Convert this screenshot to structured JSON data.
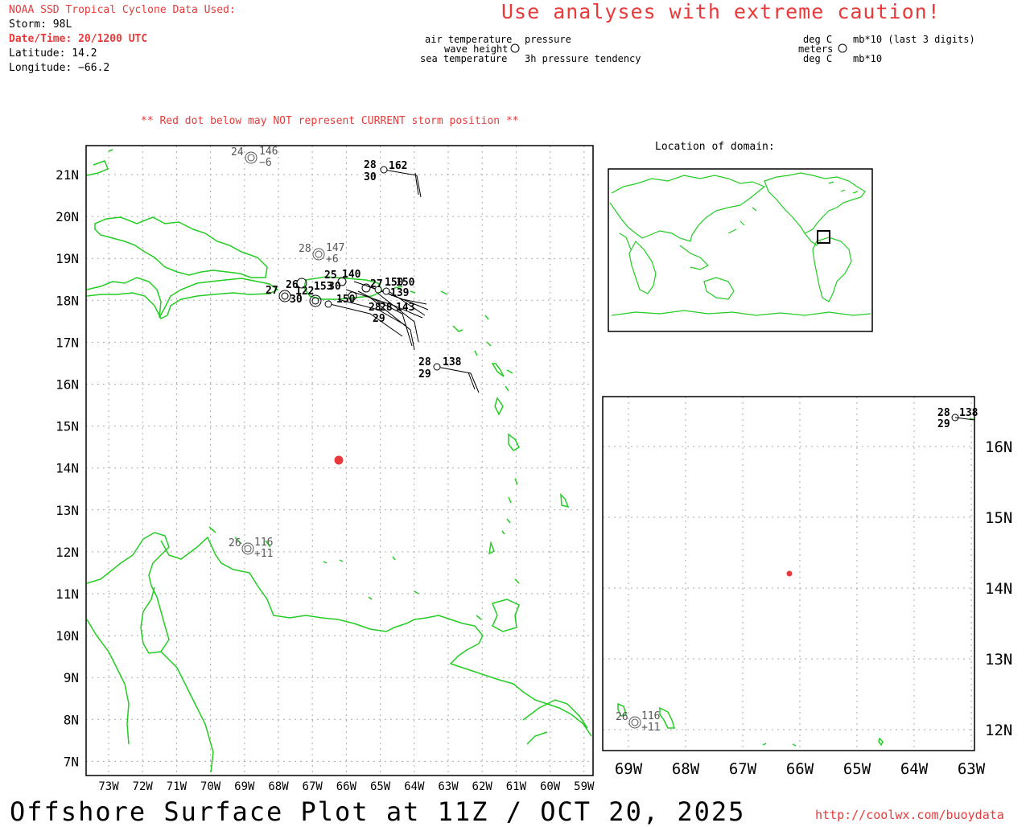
{
  "header": {
    "source": "NOAA SSD Tropical Cyclone Data Used:",
    "storm": "Storm: 98L",
    "datetime": "Date/Time: 20/1200 UTC",
    "latitude": "Latitude: 14.2",
    "longitude": "Longitude: −66.2",
    "caution": "Use analyses with extreme caution!",
    "warning": "** Red dot below may NOT represent CURRENT storm position **"
  },
  "legend": {
    "left_air": "air temperature",
    "left_wave": "wave height",
    "left_sea": "sea temperature",
    "left_pressure": "pressure",
    "left_tendency": "3h pressure tendency",
    "right_degc1": "deg C",
    "right_meters": "meters",
    "right_degc2": "deg C",
    "right_mb": "mb*10 (last 3 digits)",
    "right_mb2": "mb*10"
  },
  "main_map": {
    "lat_labels": [
      "21N",
      "20N",
      "19N",
      "18N",
      "17N",
      "16N",
      "15N",
      "14N",
      "13N",
      "12N",
      "11N",
      "10N",
      "9N",
      "8N",
      "7N"
    ],
    "lon_labels": [
      "73W",
      "72W",
      "71W",
      "70W",
      "69W",
      "68W",
      "67W",
      "66W",
      "65W",
      "64W",
      "63W",
      "62W",
      "61W",
      "60W",
      "59W"
    ],
    "stations": [
      {
        "air": "24",
        "pressure": "146",
        "tendency": "−6",
        "sea": ""
      },
      {
        "air": "28",
        "pressure": "162",
        "tendency": "",
        "sea": "30"
      },
      {
        "air": "28",
        "pressure": "147",
        "tendency": "+6",
        "sea": ""
      },
      {
        "air": "27",
        "pressure": "",
        "tendency": "",
        "sea": "30"
      },
      {
        "air": "28",
        "pressure": "138",
        "tendency": "",
        "sea": "29"
      },
      {
        "air": "26",
        "pressure": "116",
        "tendency": "+11",
        "sea": ""
      }
    ],
    "storm_dot_color": "#e83a3a"
  },
  "location_map": {
    "title": "Location of domain:"
  },
  "zoom_map": {
    "lat_labels": [
      "16N",
      "15N",
      "14N",
      "13N",
      "12N"
    ],
    "lon_labels": [
      "69W",
      "68W",
      "67W",
      "66W",
      "65W",
      "64W",
      "63W"
    ],
    "stations": [
      {
        "air": "28",
        "pressure": "138",
        "sea": "29"
      },
      {
        "air": "26",
        "pressure": "116",
        "tendency": "+11"
      }
    ]
  },
  "footer": {
    "title": "Offshore Surface Plot at 11Z / OCT 20, 2025",
    "url": "http://coolwx.com/buoydata"
  },
  "colors": {
    "land": "#22cc22",
    "red": "#e83a3a",
    "grid": "#aaaaaa"
  }
}
